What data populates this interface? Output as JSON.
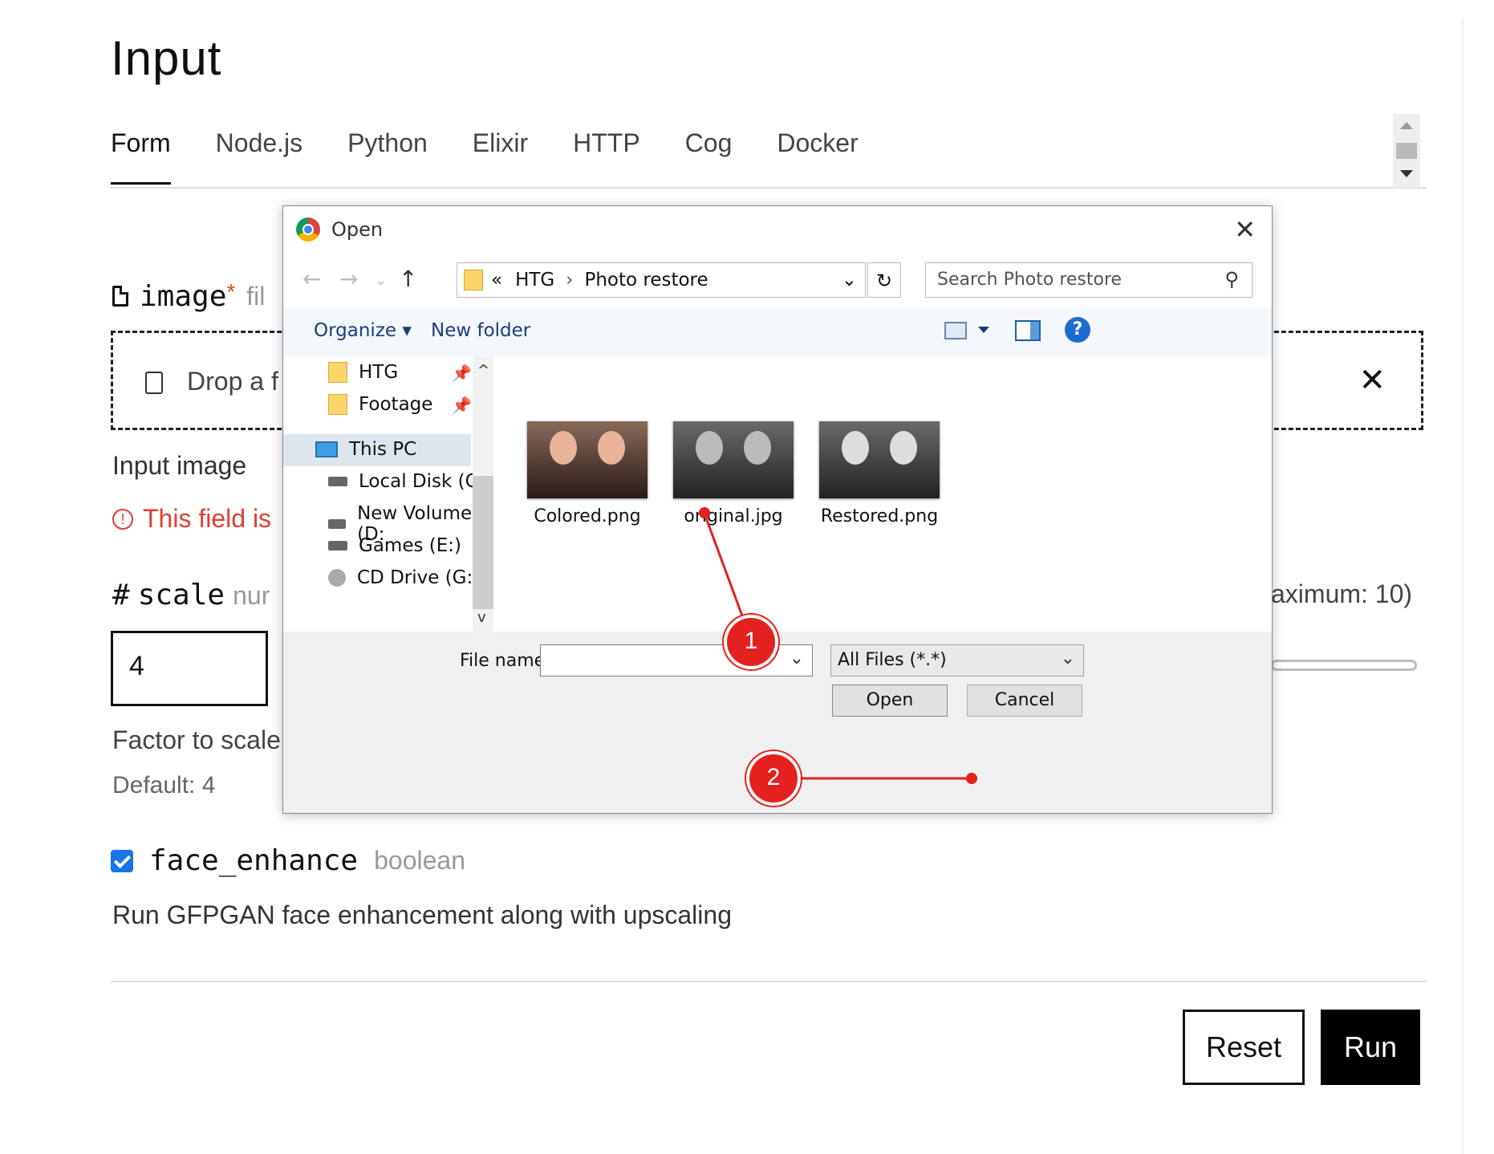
{
  "page": {
    "title": "Input",
    "tabs": [
      "Form",
      "Node.js",
      "Python",
      "Elixir",
      "HTTP",
      "Cog",
      "Docker"
    ],
    "image_field": {
      "name": "image",
      "required_mark": "*",
      "type_hint": "fil",
      "drop_text": "Drop a f",
      "description": "Input image",
      "error": "This field is"
    },
    "scale_field": {
      "name": "scale",
      "type_hint": "nur",
      "max_text": "aximum: 10)",
      "value": "4",
      "description": "Factor to scale",
      "default_text": "Default: 4"
    },
    "face_enhance": {
      "name": "face_enhance",
      "type": "boolean",
      "checked": true,
      "description": "Run GFPGAN face enhancement along with upscaling"
    },
    "buttons": {
      "reset": "Reset",
      "run": "Run"
    }
  },
  "dialog": {
    "title": "Open",
    "path": {
      "prefix": "«",
      "segments": [
        "HTG",
        "Photo restore"
      ]
    },
    "search_placeholder": "Search Photo restore",
    "toolbar": {
      "organize": "Organize",
      "new_folder": "New folder"
    },
    "nav": {
      "quick_access": [
        "HTG",
        "Footage"
      ],
      "this_pc": "This PC",
      "drives": [
        "Local Disk (C:)",
        "New Volume (D:",
        "Games (E:)",
        "CD Drive (G:)"
      ]
    },
    "files": [
      "Colored.png",
      "original.jpg",
      "Restored.png"
    ],
    "file_name_label": "File name:",
    "file_name_value": "",
    "filter": "All Files (*.*)",
    "open_label": "Open",
    "cancel_label": "Cancel"
  },
  "annotations": [
    "1",
    "2"
  ],
  "colors": {
    "accent_red": "#e3211f",
    "checkbox_blue": "#1a73e8",
    "error_red": "#e03e2f"
  }
}
